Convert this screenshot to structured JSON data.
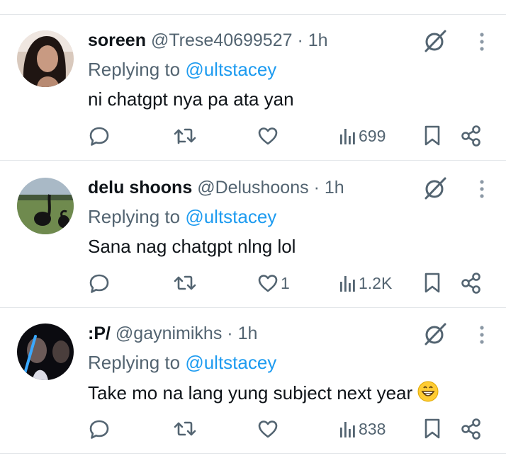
{
  "replies": [
    {
      "name": "soreen",
      "handle": "@Trese40699527",
      "time": "· 1h",
      "replying_prefix": "Replying to",
      "replying_to": "@ultstacey",
      "text": "ni chatgpt nya pa ata yan",
      "likes": "",
      "views": "699"
    },
    {
      "name": "delu shoons",
      "handle": "@Delushoons",
      "time": "· 1h",
      "replying_prefix": "Replying to",
      "replying_to": "@ultstacey",
      "text": "Sana nag chatgpt nlng lol",
      "likes": "1",
      "views": "1.2K"
    },
    {
      "name": ":P/",
      "handle": "@gaynimikhs",
      "time": "· 1h",
      "replying_prefix": "Replying to",
      "replying_to": "@ultstacey",
      "text": "Take mo na lang yung subject next year",
      "likes": "",
      "views": "838"
    }
  ],
  "icons": {
    "reply": "reply-icon",
    "retweet": "retweet-icon",
    "like": "heart-icon",
    "views": "views-icon",
    "bookmark": "bookmark-icon",
    "share": "share-icon",
    "grok": "grok-icon",
    "more": "more-vertical-icon",
    "emoji": "grinning-face-emoji-icon"
  },
  "colors": {
    "text": "#0f1419",
    "muted": "#536471",
    "link": "#1d9bf0",
    "divider": "#e3e6e9"
  }
}
